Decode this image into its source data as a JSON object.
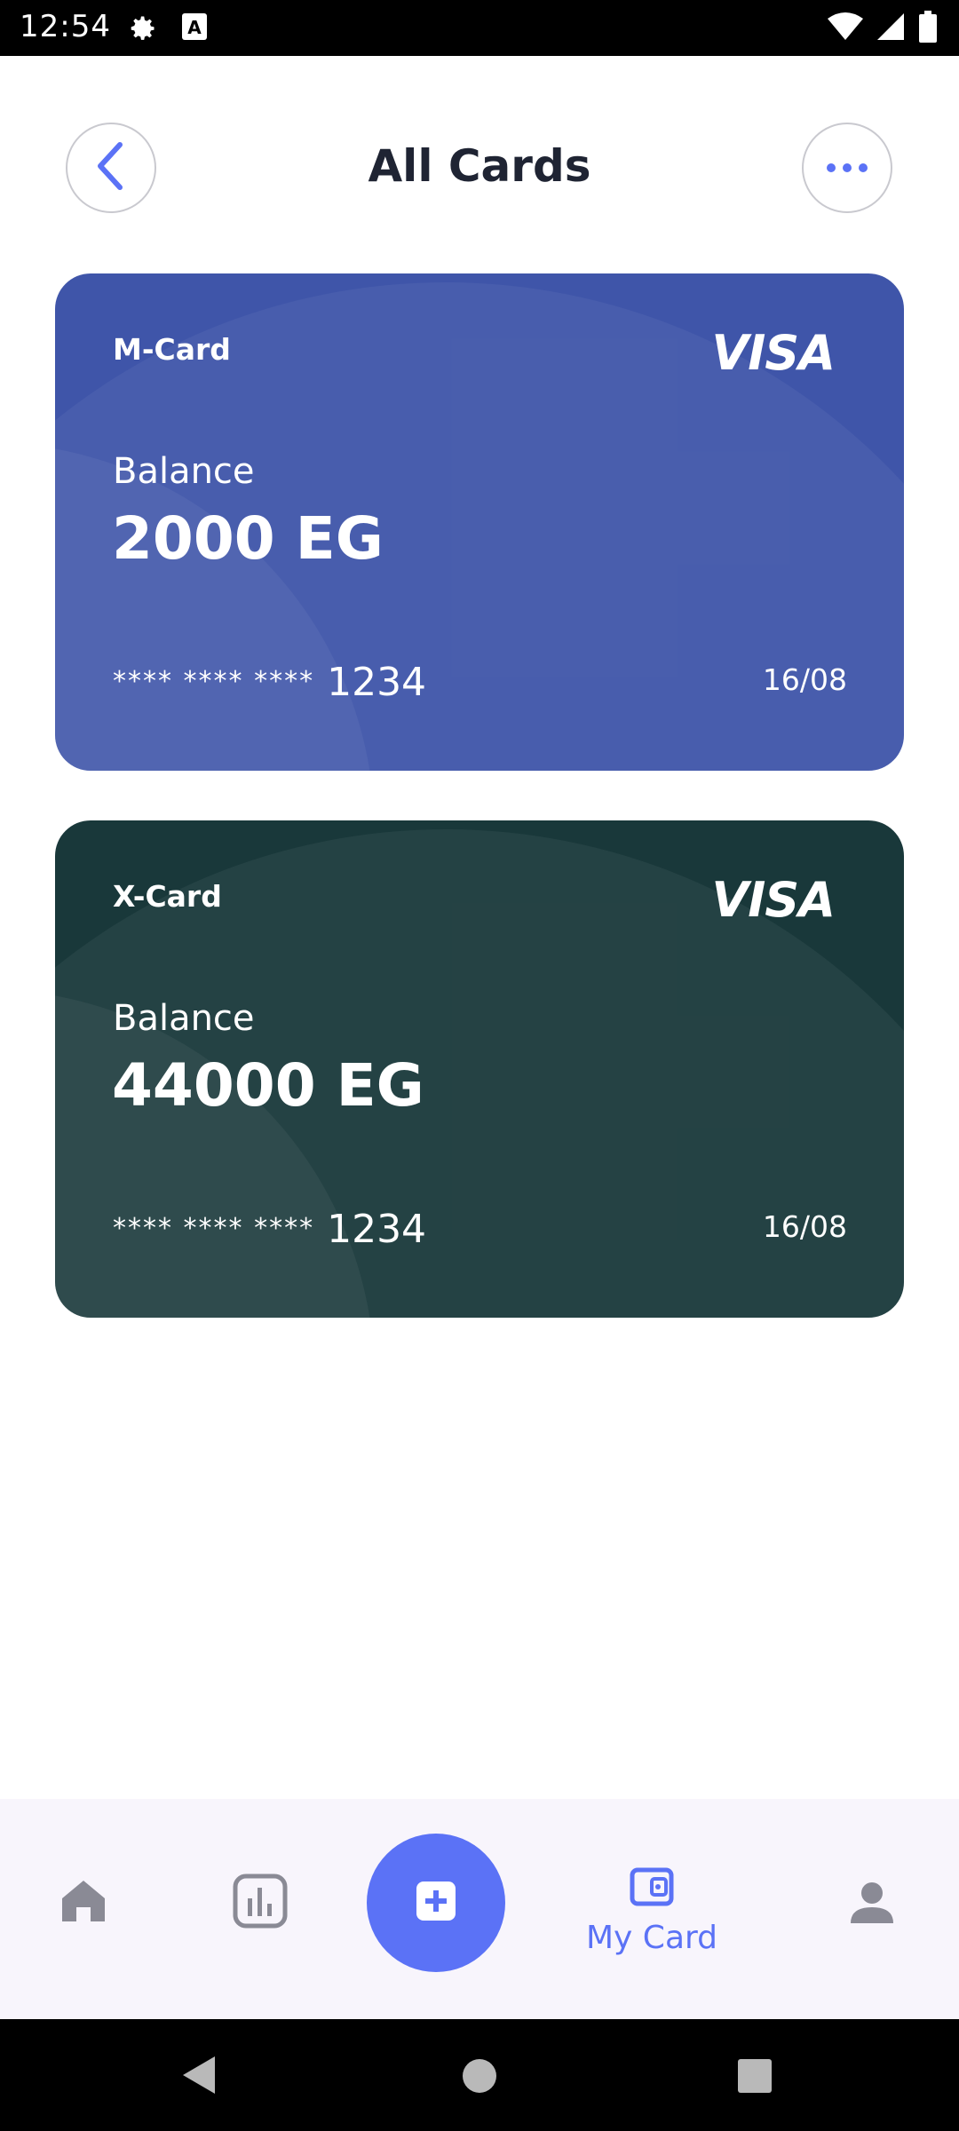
{
  "status_bar": {
    "time": "12:54",
    "icons": [
      "settings-icon",
      "text-a-icon",
      "wifi-icon",
      "signal-icon",
      "battery-icon"
    ]
  },
  "header": {
    "title": "All Cards",
    "back_icon": "chevron-left-icon",
    "more_icon": "more-horizontal-icon"
  },
  "cards": [
    {
      "name": "M-Card",
      "brand": "VISA",
      "balance_label": "Balance",
      "balance": "2000 EG",
      "number_mask": "**** **** ****",
      "number_last4": "1234",
      "expiry": "16/08",
      "color": "#3f55a9"
    },
    {
      "name": "X-Card",
      "brand": "VISA",
      "balance_label": "Balance",
      "balance": "44000 EG",
      "number_mask": "**** **** ****",
      "number_last4": "1234",
      "expiry": "16/08",
      "color": "#19383a"
    }
  ],
  "bottom_nav": {
    "items": [
      {
        "icon": "home-icon",
        "label": ""
      },
      {
        "icon": "stats-icon",
        "label": ""
      },
      {
        "icon": "add-icon",
        "label": ""
      },
      {
        "icon": "wallet-icon",
        "label": "My Card"
      },
      {
        "icon": "profile-icon",
        "label": ""
      }
    ],
    "active_color": "#5b72f6",
    "inactive_color": "#8a8a95"
  }
}
